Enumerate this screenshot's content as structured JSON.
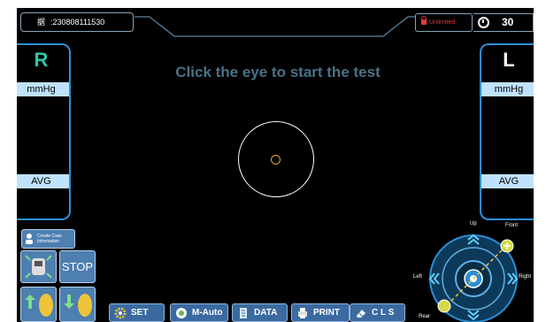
{
  "header": {
    "id_label": "据",
    "id_value": ":230808111530",
    "license": "Unlimited",
    "timer": "30"
  },
  "prompt": "Click the eye to start the test",
  "right_eye": {
    "letter": "R",
    "unit": "mmHg",
    "avg_label": "AVG"
  },
  "left_eye": {
    "letter": "L",
    "unit": "mmHg",
    "avg_label": "AVG"
  },
  "case_button": {
    "line1": "Create Case",
    "line2": "Information"
  },
  "stop_label": "STOP",
  "buttons": {
    "set": "SET",
    "mauto": "M-Auto",
    "data": "DATA",
    "print": "PRINT",
    "cls": "C L S"
  },
  "joystick": {
    "up": "Up",
    "front": "Front",
    "left": "Left",
    "right": "Right",
    "rear": "Rear"
  },
  "colors": {
    "accent": "#2b8fd6",
    "prompt": "#4a7189",
    "license": "#e23b3b",
    "fixation": "#e0a826",
    "bar": "#bfe3ff"
  }
}
